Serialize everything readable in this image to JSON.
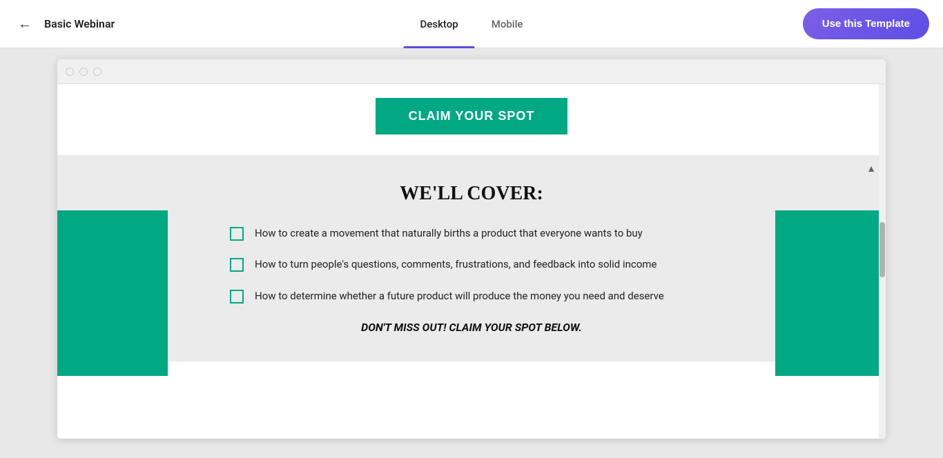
{
  "header": {
    "back_icon": "←",
    "title": "Basic Webinar",
    "tabs": [
      {
        "id": "desktop",
        "label": "Desktop",
        "active": true
      },
      {
        "id": "mobile",
        "label": "Mobile",
        "active": false
      }
    ],
    "cta_label": "Use this Template"
  },
  "browser": {
    "dots": [
      "dot1",
      "dot2",
      "dot3"
    ]
  },
  "page": {
    "claim_button": "CLAIM YOUR SPOT",
    "cover_title": "WE'LL COVER:",
    "list_items": [
      {
        "text": "How to create a movement that naturally births a product that everyone wants to buy"
      },
      {
        "text": "How to turn people's questions, comments, frustrations, and feedback into solid income"
      },
      {
        "text": "How to determine whether a future product will produce the money you need and deserve"
      }
    ],
    "footer_text": "DON'T MISS OUT! CLAIM YOUR SPOT BELOW."
  },
  "colors": {
    "teal": "#00a884",
    "purple": "#5c4ee5",
    "tab_active_bar": "#5c4ee5"
  }
}
